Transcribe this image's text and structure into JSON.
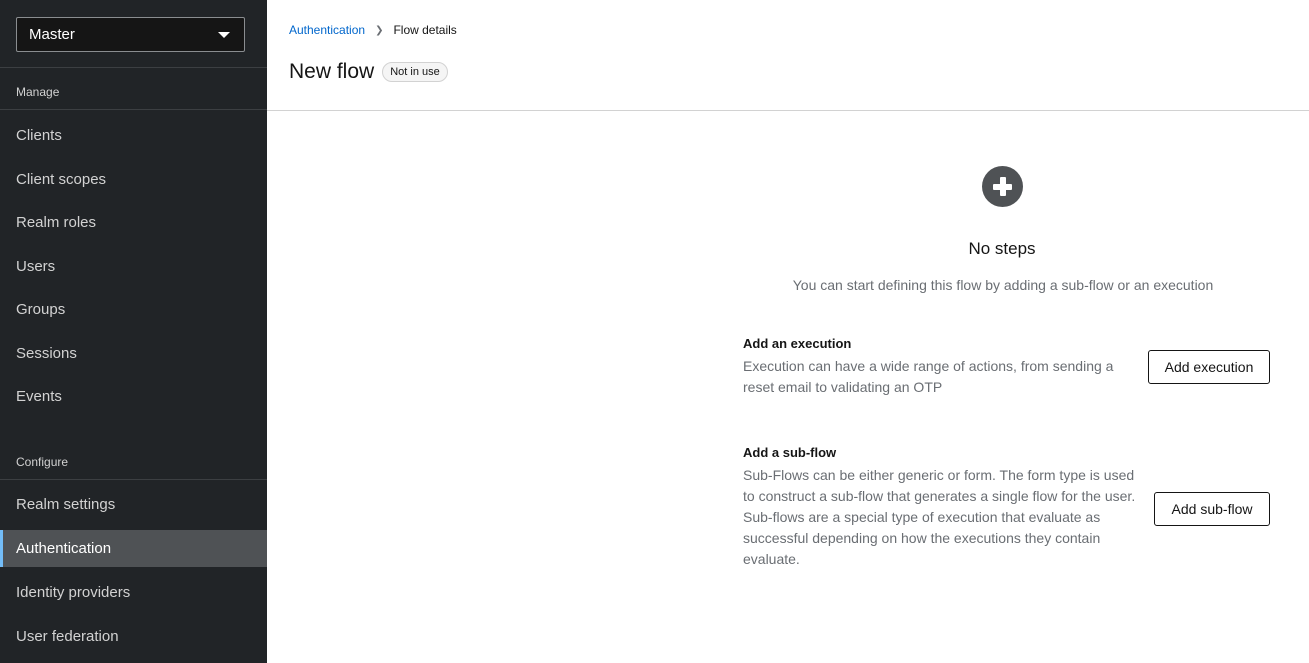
{
  "sidebar": {
    "realm": "Master",
    "sections": [
      {
        "title": "Manage",
        "items": [
          "Clients",
          "Client scopes",
          "Realm roles",
          "Users",
          "Groups",
          "Sessions",
          "Events"
        ]
      },
      {
        "title": "Configure",
        "items": [
          "Realm settings",
          "Authentication",
          "Identity providers",
          "User federation"
        ]
      }
    ],
    "active": "Authentication"
  },
  "breadcrumb": {
    "parent": "Authentication",
    "current": "Flow details"
  },
  "page": {
    "title": "New flow",
    "badge": "Not in use"
  },
  "empty_state": {
    "icon": "plus-circle-icon",
    "title": "No steps",
    "description": "You can start defining this flow by adding a sub-flow or an execution",
    "options": [
      {
        "title": "Add an execution",
        "description": "Execution can have a wide range of actions, from sending a reset email to validating an OTP",
        "button": "Add execution"
      },
      {
        "title": "Add a sub-flow",
        "description": "Sub-Flows can be either generic or form. The form type is used to construct a sub-flow that generates a single flow for the user. Sub-flows are a special type of execution that evaluate as successful depending on how the executions they contain evaluate.",
        "button": "Add sub-flow"
      }
    ]
  },
  "colors": {
    "sidebar_bg": "#212427",
    "active_bg": "#4f5255",
    "active_accent": "#73bcf7",
    "link": "#0066cc"
  }
}
